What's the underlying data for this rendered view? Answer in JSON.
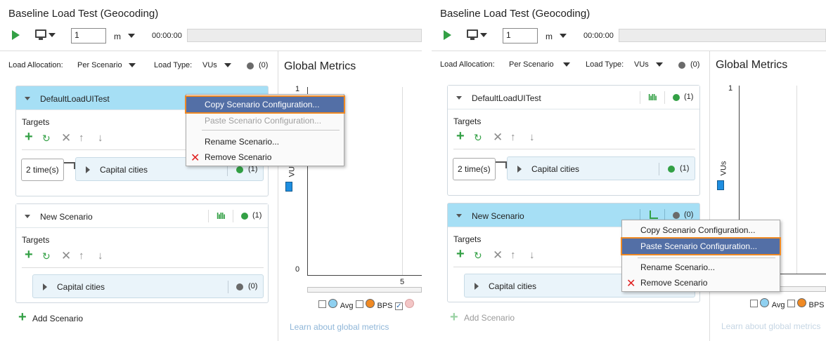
{
  "left": {
    "title": "Baseline Load Test (Geocoding)",
    "duration_value": "1",
    "duration_unit": "m",
    "elapsed": "00:00:00",
    "allocation_label": "Load Allocation:",
    "allocation_value": "Per Scenario",
    "load_type_label": "Load Type:",
    "load_type_value": "VUs",
    "total_count": "(0)",
    "scenario1": {
      "name": "DefaultLoadUITest",
      "targets_label": "Targets",
      "times": "2 time(s)",
      "target_name": "Capital cities",
      "target_count": "(1)"
    },
    "scenario2": {
      "name": "New Scenario",
      "count": "(1)",
      "targets_label": "Targets",
      "target_name": "Capital cities",
      "target_count": "(0)"
    },
    "add_scenario": "Add Scenario",
    "metrics": {
      "title": "Global Metrics",
      "y_top": "1",
      "y_bottom": "0",
      "x_tick": "5",
      "y_axis": "VUs",
      "legend_avg": "Avg",
      "legend_bps": "BPS",
      "link": "Learn about global metrics"
    },
    "menu": {
      "copy": "Copy Scenario Configuration...",
      "paste": "Paste Scenario Configuration...",
      "rename": "Rename Scenario...",
      "remove": "Remove Scenario"
    }
  },
  "right": {
    "title": "Baseline Load Test (Geocoding)",
    "duration_value": "1",
    "duration_unit": "m",
    "elapsed": "00:00:00",
    "allocation_label": "Load Allocation:",
    "allocation_value": "Per Scenario",
    "load_type_label": "Load Type:",
    "load_type_value": "VUs",
    "total_count": "(0)",
    "scenario1": {
      "name": "DefaultLoadUITest",
      "count": "(1)",
      "targets_label": "Targets",
      "times": "2 time(s)",
      "target_name": "Capital cities",
      "target_count": "(1)"
    },
    "scenario2": {
      "name": "New Scenario",
      "count": "(0)",
      "targets_label": "Targets",
      "target_name": "Capital cities"
    },
    "add_scenario": "Add Scenario",
    "metrics": {
      "title": "Global Metrics",
      "y_top": "1",
      "y_axis": "VUs",
      "legend_avg": "Avg",
      "legend_bps": "BPS",
      "link": "Learn about global metrics"
    },
    "menu": {
      "copy": "Copy Scenario Configuration...",
      "paste": "Paste Scenario Configuration...",
      "rename": "Rename Scenario...",
      "remove": "Remove Scenario"
    }
  },
  "colors": {
    "accent_green": "#33a045",
    "selection_blue": "#a6dff5",
    "menu_highlight": "#536fa6",
    "highlight_outline": "#f08a24",
    "remove_red": "#e02020"
  }
}
